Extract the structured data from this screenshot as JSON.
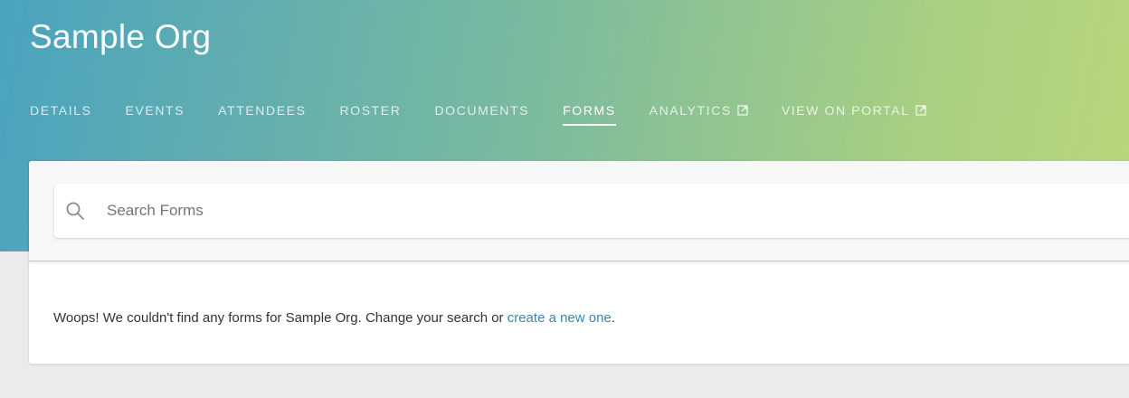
{
  "header": {
    "org_title": "Sample Org"
  },
  "nav": {
    "tabs": [
      {
        "label": "DETAILS",
        "active": false,
        "external": false
      },
      {
        "label": "EVENTS",
        "active": false,
        "external": false
      },
      {
        "label": "ATTENDEES",
        "active": false,
        "external": false
      },
      {
        "label": "ROSTER",
        "active": false,
        "external": false
      },
      {
        "label": "DOCUMENTS",
        "active": false,
        "external": false
      },
      {
        "label": "FORMS",
        "active": true,
        "external": false
      },
      {
        "label": "ANALYTICS",
        "active": false,
        "external": true
      },
      {
        "label": "VIEW ON PORTAL",
        "active": false,
        "external": true
      }
    ]
  },
  "search": {
    "placeholder": "Search Forms",
    "value": "",
    "icon": "search-icon"
  },
  "empty_state": {
    "message": "Woops! We couldn't find any forms for Sample Org.  Change your search or ",
    "link_label": "create a new one",
    "suffix": "."
  },
  "colors": {
    "link": "#3a86b8",
    "gradient_start": "#4aa3be",
    "gradient_end": "#b9d67a",
    "page_background": "#ebebeb"
  }
}
